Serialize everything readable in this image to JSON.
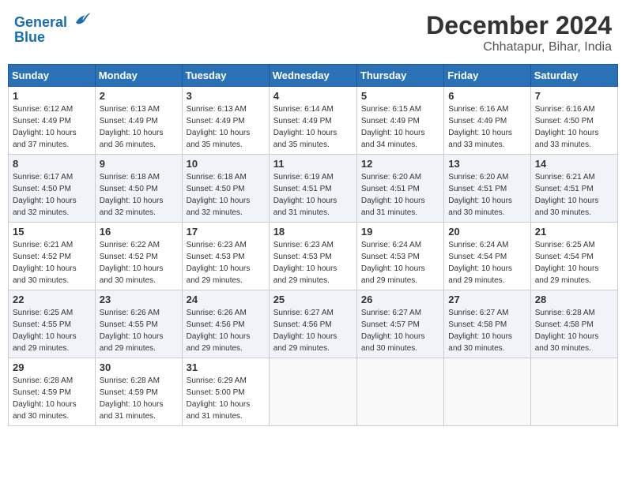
{
  "logo": {
    "general": "General",
    "blue": "Blue"
  },
  "title": "December 2024",
  "location": "Chhatapur, Bihar, India",
  "weekdays": [
    "Sunday",
    "Monday",
    "Tuesday",
    "Wednesday",
    "Thursday",
    "Friday",
    "Saturday"
  ],
  "weeks": [
    [
      {
        "day": "1",
        "sunrise": "6:12 AM",
        "sunset": "4:49 PM",
        "daylight": "10 hours and 37 minutes."
      },
      {
        "day": "2",
        "sunrise": "6:13 AM",
        "sunset": "4:49 PM",
        "daylight": "10 hours and 36 minutes."
      },
      {
        "day": "3",
        "sunrise": "6:13 AM",
        "sunset": "4:49 PM",
        "daylight": "10 hours and 35 minutes."
      },
      {
        "day": "4",
        "sunrise": "6:14 AM",
        "sunset": "4:49 PM",
        "daylight": "10 hours and 35 minutes."
      },
      {
        "day": "5",
        "sunrise": "6:15 AM",
        "sunset": "4:49 PM",
        "daylight": "10 hours and 34 minutes."
      },
      {
        "day": "6",
        "sunrise": "6:16 AM",
        "sunset": "4:49 PM",
        "daylight": "10 hours and 33 minutes."
      },
      {
        "day": "7",
        "sunrise": "6:16 AM",
        "sunset": "4:50 PM",
        "daylight": "10 hours and 33 minutes."
      }
    ],
    [
      {
        "day": "8",
        "sunrise": "6:17 AM",
        "sunset": "4:50 PM",
        "daylight": "10 hours and 32 minutes."
      },
      {
        "day": "9",
        "sunrise": "6:18 AM",
        "sunset": "4:50 PM",
        "daylight": "10 hours and 32 minutes."
      },
      {
        "day": "10",
        "sunrise": "6:18 AM",
        "sunset": "4:50 PM",
        "daylight": "10 hours and 32 minutes."
      },
      {
        "day": "11",
        "sunrise": "6:19 AM",
        "sunset": "4:51 PM",
        "daylight": "10 hours and 31 minutes."
      },
      {
        "day": "12",
        "sunrise": "6:20 AM",
        "sunset": "4:51 PM",
        "daylight": "10 hours and 31 minutes."
      },
      {
        "day": "13",
        "sunrise": "6:20 AM",
        "sunset": "4:51 PM",
        "daylight": "10 hours and 30 minutes."
      },
      {
        "day": "14",
        "sunrise": "6:21 AM",
        "sunset": "4:51 PM",
        "daylight": "10 hours and 30 minutes."
      }
    ],
    [
      {
        "day": "15",
        "sunrise": "6:21 AM",
        "sunset": "4:52 PM",
        "daylight": "10 hours and 30 minutes."
      },
      {
        "day": "16",
        "sunrise": "6:22 AM",
        "sunset": "4:52 PM",
        "daylight": "10 hours and 30 minutes."
      },
      {
        "day": "17",
        "sunrise": "6:23 AM",
        "sunset": "4:53 PM",
        "daylight": "10 hours and 29 minutes."
      },
      {
        "day": "18",
        "sunrise": "6:23 AM",
        "sunset": "4:53 PM",
        "daylight": "10 hours and 29 minutes."
      },
      {
        "day": "19",
        "sunrise": "6:24 AM",
        "sunset": "4:53 PM",
        "daylight": "10 hours and 29 minutes."
      },
      {
        "day": "20",
        "sunrise": "6:24 AM",
        "sunset": "4:54 PM",
        "daylight": "10 hours and 29 minutes."
      },
      {
        "day": "21",
        "sunrise": "6:25 AM",
        "sunset": "4:54 PM",
        "daylight": "10 hours and 29 minutes."
      }
    ],
    [
      {
        "day": "22",
        "sunrise": "6:25 AM",
        "sunset": "4:55 PM",
        "daylight": "10 hours and 29 minutes."
      },
      {
        "day": "23",
        "sunrise": "6:26 AM",
        "sunset": "4:55 PM",
        "daylight": "10 hours and 29 minutes."
      },
      {
        "day": "24",
        "sunrise": "6:26 AM",
        "sunset": "4:56 PM",
        "daylight": "10 hours and 29 minutes."
      },
      {
        "day": "25",
        "sunrise": "6:27 AM",
        "sunset": "4:56 PM",
        "daylight": "10 hours and 29 minutes."
      },
      {
        "day": "26",
        "sunrise": "6:27 AM",
        "sunset": "4:57 PM",
        "daylight": "10 hours and 30 minutes."
      },
      {
        "day": "27",
        "sunrise": "6:27 AM",
        "sunset": "4:58 PM",
        "daylight": "10 hours and 30 minutes."
      },
      {
        "day": "28",
        "sunrise": "6:28 AM",
        "sunset": "4:58 PM",
        "daylight": "10 hours and 30 minutes."
      }
    ],
    [
      {
        "day": "29",
        "sunrise": "6:28 AM",
        "sunset": "4:59 PM",
        "daylight": "10 hours and 30 minutes."
      },
      {
        "day": "30",
        "sunrise": "6:28 AM",
        "sunset": "4:59 PM",
        "daylight": "10 hours and 31 minutes."
      },
      {
        "day": "31",
        "sunrise": "6:29 AM",
        "sunset": "5:00 PM",
        "daylight": "10 hours and 31 minutes."
      },
      null,
      null,
      null,
      null
    ]
  ]
}
